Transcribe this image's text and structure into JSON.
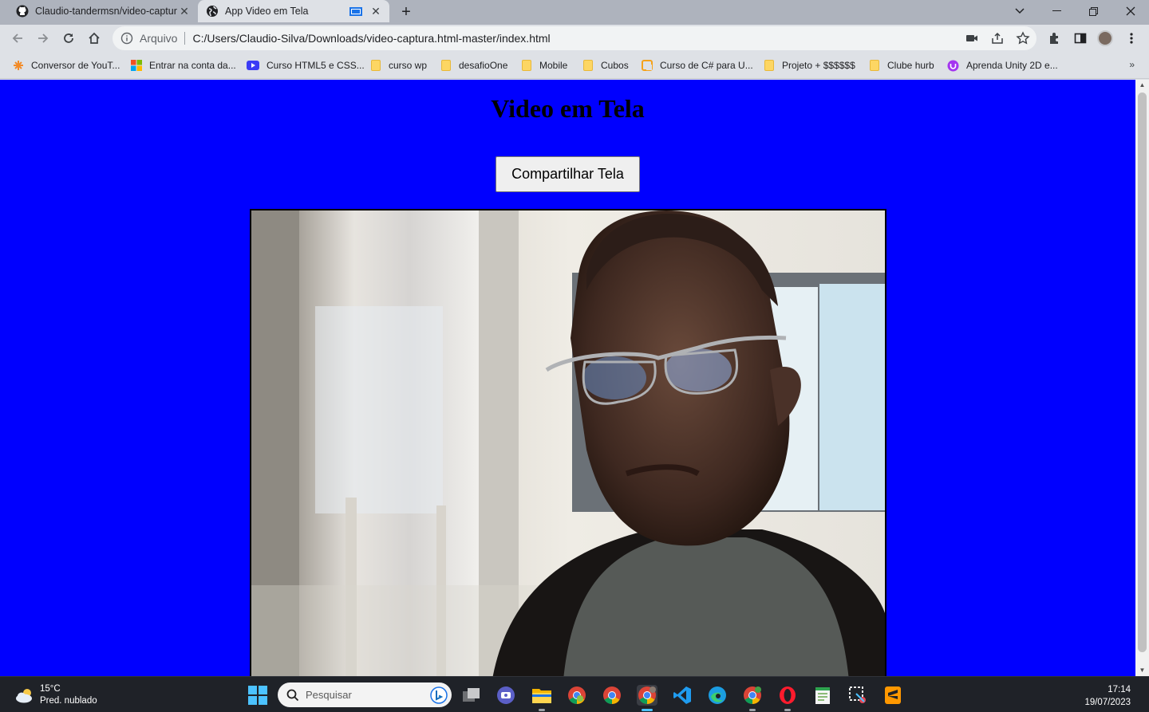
{
  "tabs": [
    {
      "title": "Claudio-tandermsn/video-captur",
      "icon": "github-icon",
      "active": false
    },
    {
      "title": "App Video em Tela",
      "icon": "globe-icon",
      "active": true
    }
  ],
  "toolbar": {
    "scheme": "Arquivo",
    "url": "C:/Users/Claudio-Silva/Downloads/video-captura.html-master/index.html"
  },
  "bookmarks": [
    {
      "label": "Conversor de YouT...",
      "icon": "converter-icon"
    },
    {
      "label": "Entrar na conta da...",
      "icon": "microsoft-icon"
    },
    {
      "label": "Curso HTML5 e CSS...",
      "icon": "youtube-icon"
    },
    {
      "label": "curso wp",
      "icon": "folder-icon"
    },
    {
      "label": "desafioOne",
      "icon": "folder-icon"
    },
    {
      "label": "Mobile",
      "icon": "folder-icon"
    },
    {
      "label": "Cubos",
      "icon": "folder-icon"
    },
    {
      "label": "Curso de C# para U...",
      "icon": "udemy-icon"
    },
    {
      "label": "Projeto + $$$$$$",
      "icon": "folder-icon"
    },
    {
      "label": "Clube hurb",
      "icon": "folder-icon"
    },
    {
      "label": "Aprenda Unity 2D e...",
      "icon": "udemy-purple-icon"
    }
  ],
  "bookmarks_more": "»",
  "page": {
    "heading": "Video em Tela",
    "share_button": "Compartilhar Tela",
    "background": "#0000ff"
  },
  "taskbar": {
    "weather_temp": "15°C",
    "weather_desc": "Pred. nublado",
    "search_placeholder": "Pesquisar",
    "time": "17:14",
    "date": "19/07/2023",
    "apps": [
      "task-view-icon",
      "teams-icon",
      "file-explorer-icon",
      "chrome-icon",
      "chrome-icon",
      "chrome-icon",
      "vscode-icon",
      "edge-icon",
      "chrome-canary-icon",
      "opera-icon",
      "notepad-icon",
      "snipping-icon",
      "sublime-icon"
    ]
  }
}
